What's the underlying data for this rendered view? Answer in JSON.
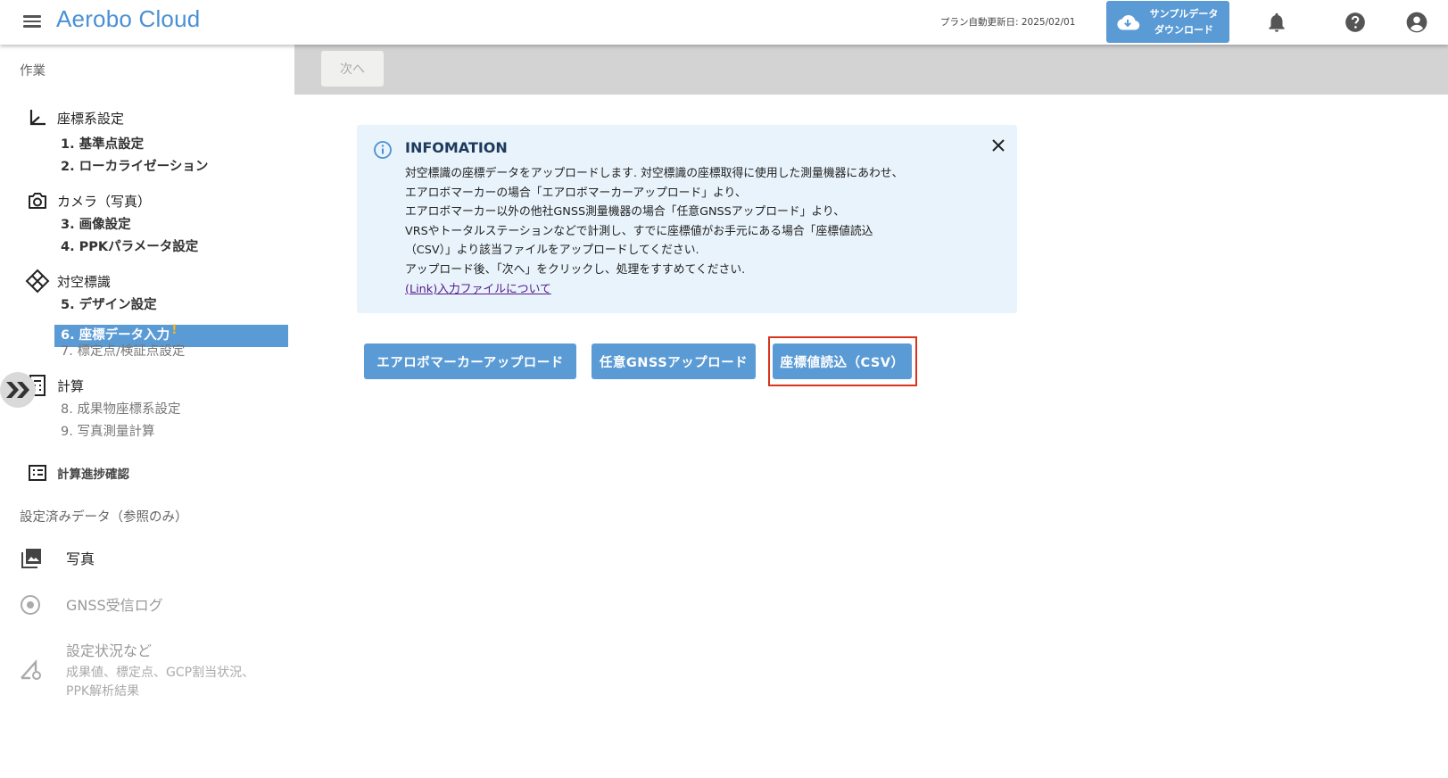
{
  "header": {
    "app_title": "Aerobo Cloud",
    "plan_update": "プラン自動更新日: 2025/02/01",
    "sample_btn_line1": "サンプルデータ",
    "sample_btn_line2": "ダウンロード"
  },
  "sidebar": {
    "section_work": "作業",
    "groups": [
      {
        "label": "座標系設定",
        "icon": "axis-icon"
      },
      {
        "label": "カメラ（写真）",
        "icon": "camera-icon"
      },
      {
        "label": "対空標識",
        "icon": "target-icon"
      },
      {
        "label": "計算",
        "icon": "calculator-icon"
      },
      {
        "label": "計算進捗確認",
        "icon": "list-icon"
      }
    ],
    "items": [
      "1. 基準点設定",
      "2. ローカライゼーション",
      "3. 画像設定",
      "4. PPKパラメータ設定",
      "5. デザイン設定",
      "6. 座標データ入力",
      "7. 標定点/検証点設定",
      "8. 成果物座標系設定",
      "9. 写真測量計算"
    ],
    "active_warning": "!",
    "section_reference": "設定済みデータ（参照のみ）",
    "reference": [
      {
        "label": "写真",
        "icon": "photo-library-icon"
      },
      {
        "label": "GNSS受信ログ",
        "icon": "radio-icon"
      },
      {
        "label": "設定状況など",
        "icon": "signal-settings-icon",
        "sub1": "成果値、標定点、GCP割当状況、",
        "sub2": "PPK解析結果"
      }
    ]
  },
  "toolbar": {
    "next_label": "次へ"
  },
  "info": {
    "title": "INFOMATION",
    "lines": [
      "対空標識の座標データをアップロードします. 対空標識の座標取得に使用した測量機器にあわせ、",
      "エアロボマーカーの場合「エアロボマーカーアップロード」より、",
      "エアロボマーカー以外の他社GNSS測量機器の場合「任意GNSSアップロード」より、",
      "VRSやトータルステーションなどで計測し、すでに座標値がお手元にある場合「座標値読込",
      "（CSV）」より該当ファイルをアップロードしてください.",
      "アップロード後、「次へ」をクリックし、処理をすすめてください."
    ],
    "link": "(Link)入力ファイルについて"
  },
  "actions": {
    "aerobo_upload": "エアロボマーカーアップロード",
    "gnss_upload": "任意GNSSアップロード",
    "csv_import": "座標値読込（CSV）"
  },
  "colors": {
    "brand": "#4a90d4",
    "button": "#5b9bd5",
    "highlight": "#d9341e",
    "warning": "#f2b81c"
  }
}
